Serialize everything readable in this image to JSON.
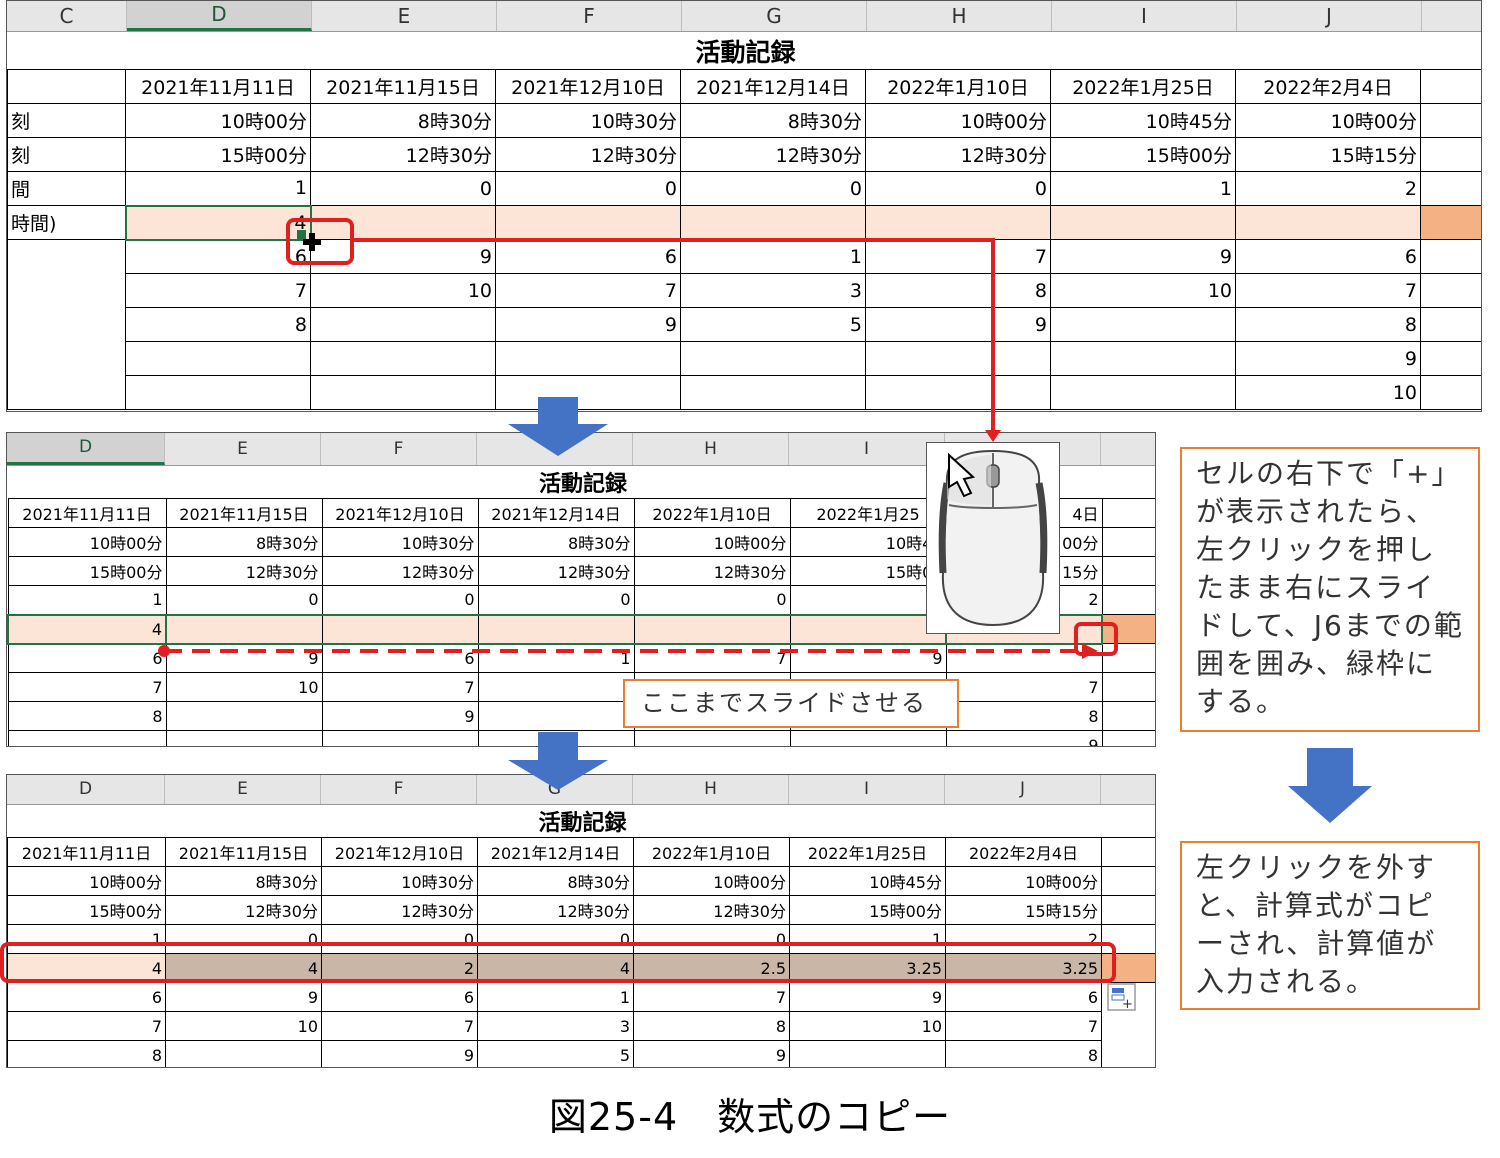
{
  "sheet_title": "活動記録",
  "panel1": {
    "col_headers": [
      "C",
      "D",
      "E",
      "F",
      "G",
      "H",
      "I",
      "J"
    ],
    "dates": [
      "2021年11月11日",
      "2021年11月15日",
      "2021年12月10日",
      "2021年12月14日",
      "2022年1月10日",
      "2022年1月25日",
      "2022年2月4日"
    ],
    "row_labels": [
      "刻",
      "刻",
      "間",
      "時間)"
    ],
    "start_times": [
      "10時00分",
      "8時30分",
      "10時30分",
      "8時30分",
      "10時00分",
      "10時45分",
      "10時00分"
    ],
    "end_times": [
      "15時00分",
      "12時30分",
      "12時30分",
      "12時30分",
      "12時30分",
      "15時00分",
      "15時15分"
    ],
    "row_counts": [
      "1",
      "0",
      "0",
      "0",
      "0",
      "1",
      "2"
    ],
    "avg_first": "4",
    "data_rows": [
      [
        "6",
        "9",
        "6",
        "1",
        "7",
        "9",
        "6"
      ],
      [
        "7",
        "10",
        "7",
        "3",
        "8",
        "10",
        "7"
      ],
      [
        "8",
        "",
        "9",
        "5",
        "9",
        "",
        "8"
      ],
      [
        "",
        "",
        "",
        "",
        "",
        "",
        "9"
      ],
      [
        "",
        "",
        "",
        "",
        "",
        "",
        "10"
      ]
    ]
  },
  "panel2": {
    "col_headers": [
      "D",
      "E",
      "F",
      "G",
      "H",
      "I",
      ""
    ],
    "dates": [
      "2021年11月11日",
      "2021年11月15日",
      "2021年12月10日",
      "2021年12月14日",
      "2022年1月10日",
      "2022年1月25",
      "4日"
    ],
    "start_times": [
      "10時00分",
      "8時30分",
      "10時30分",
      "8時30分",
      "10時00分",
      "10時45",
      "00分"
    ],
    "end_times": [
      "15時00分",
      "12時30分",
      "12時30分",
      "12時30分",
      "12時30分",
      "15時00",
      "15分"
    ],
    "row_counts": [
      "1",
      "0",
      "0",
      "0",
      "0",
      "",
      "2"
    ],
    "avg_first": "4",
    "data_rows": [
      [
        "6",
        "9",
        "6",
        "1",
        "7",
        "9",
        ""
      ],
      [
        "7",
        "10",
        "7",
        "",
        "",
        "",
        "7"
      ],
      [
        "8",
        "",
        "9",
        "",
        "",
        "",
        "8"
      ],
      [
        "",
        "",
        "",
        "",
        "",
        "",
        "9"
      ]
    ]
  },
  "panel3": {
    "col_headers": [
      "D",
      "E",
      "F",
      "G",
      "H",
      "I",
      "J"
    ],
    "dates": [
      "2021年11月11日",
      "2021年11月15日",
      "2021年12月10日",
      "2021年12月14日",
      "2022年1月10日",
      "2022年1月25日",
      "2022年2月4日"
    ],
    "start_times": [
      "10時00分",
      "8時30分",
      "10時30分",
      "8時30分",
      "10時00分",
      "10時45分",
      "10時00分"
    ],
    "end_times": [
      "15時00分",
      "12時30分",
      "12時30分",
      "12時30分",
      "12時30分",
      "15時00分",
      "15時15分"
    ],
    "row_counts": [
      "1",
      "0",
      "0",
      "0",
      "0",
      "1",
      "2"
    ],
    "averages": [
      "4",
      "4",
      "2",
      "4",
      "2.5",
      "3.25",
      "3.25"
    ],
    "data_rows": [
      [
        "6",
        "9",
        "6",
        "1",
        "7",
        "9",
        "6"
      ],
      [
        "7",
        "10",
        "7",
        "3",
        "8",
        "10",
        "7"
      ],
      [
        "8",
        "",
        "9",
        "5",
        "9",
        "",
        "8"
      ]
    ]
  },
  "notes": {
    "slide_here": "ここまでスライドさせる",
    "instruction": "セルの右下で「+」が表示されたら、左クリックを押したまま右にスライドして、J6までの範囲を囲み、緑枠にする。",
    "result": "左クリックを外すと、計算式がコピーされ、計算値が入力される。"
  },
  "caption": "図25-4　数式のコピー",
  "icons": [
    "mouse-icon",
    "fill-handle-cursor-icon",
    "autofill-options-icon",
    "arrow-down-icon"
  ],
  "colors": {
    "red": "#e02020",
    "blue": "#4472c4",
    "orange": "#ed7d31",
    "pink": "#fce4d6",
    "excel_green": "#217346"
  }
}
